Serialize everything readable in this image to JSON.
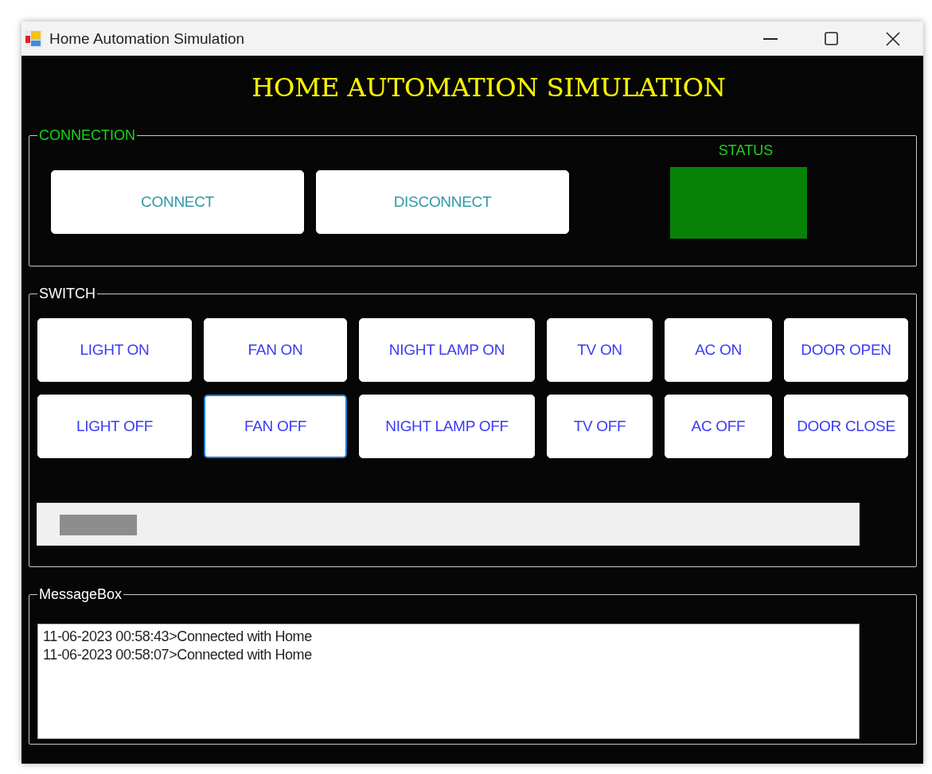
{
  "window": {
    "title": "Home Automation Simulation"
  },
  "heading": "HOME AUTOMATION SIMULATION",
  "connection": {
    "label": "CONNECTION",
    "buttons": [
      {
        "label": "CONNECT",
        "focused": false
      },
      {
        "label": "DISCONNECT",
        "focused": false
      }
    ],
    "status": {
      "label": "STATUS",
      "connected": true
    }
  },
  "switch": {
    "label": "SWITCH",
    "buttons": [
      {
        "label": "LIGHT ON",
        "focused": false
      },
      {
        "label": "FAN ON",
        "focused": false
      },
      {
        "label": "NIGHT LAMP ON",
        "focused": false
      },
      {
        "label": "TV ON",
        "focused": false
      },
      {
        "label": "AC ON",
        "focused": false
      },
      {
        "label": "DOOR OPEN",
        "focused": false
      },
      {
        "label": "LIGHT OFF",
        "focused": false
      },
      {
        "label": "FAN OFF",
        "focused": true
      },
      {
        "label": "NIGHT LAMP OFF",
        "focused": false
      },
      {
        "label": "TV OFF",
        "focused": false
      },
      {
        "label": "AC OFF",
        "focused": false
      },
      {
        "label": "DOOR CLOSE",
        "focused": false
      }
    ]
  },
  "progress": {
    "level": 0.094
  },
  "message_box": {
    "label": "MessageBox",
    "lines": [
      "11-06-2023 00:58:43>Connected with Home",
      "11-06-2023 00:58:07>Connected with Home"
    ]
  }
}
